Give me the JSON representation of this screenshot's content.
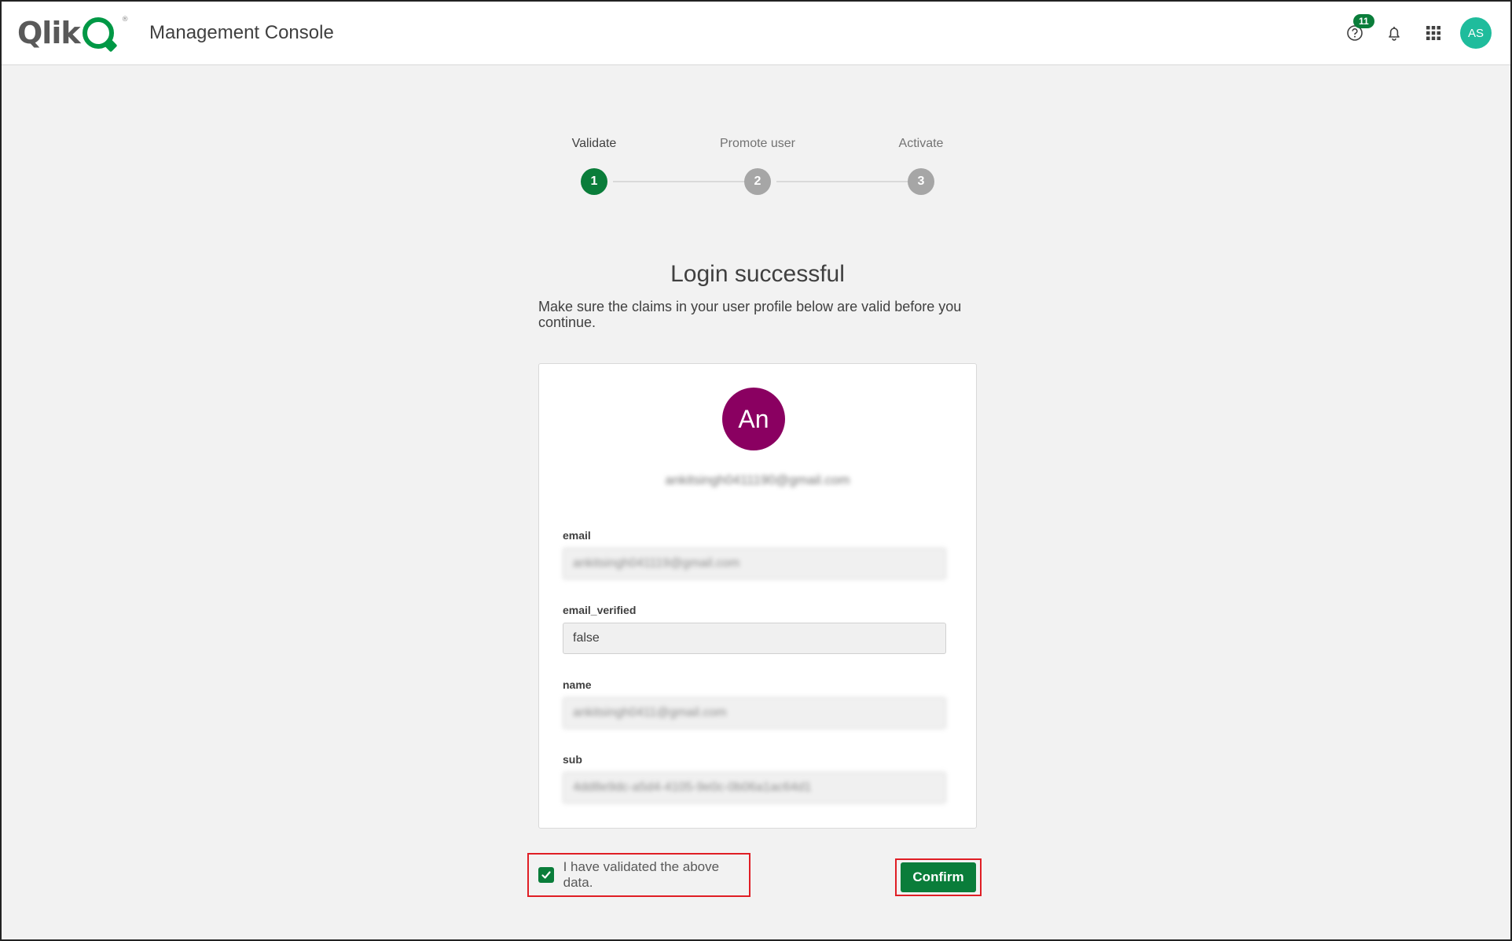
{
  "header": {
    "logo_text": "Qlik",
    "logo_reg": "®",
    "title": "Management Console",
    "help_badge_count": "11",
    "user_initials": "AS",
    "icons": [
      "help-icon",
      "bell-icon",
      "apps-grid-icon"
    ]
  },
  "stepper": {
    "steps": [
      {
        "label": "Validate",
        "number": "1",
        "state": "active"
      },
      {
        "label": "Promote user",
        "number": "2",
        "state": "inactive"
      },
      {
        "label": "Activate",
        "number": "3",
        "state": "inactive"
      }
    ]
  },
  "main": {
    "heading": "Login successful",
    "subtext": "Make sure the claims in your user profile below are valid before you continue."
  },
  "profile": {
    "avatar_initials": "An",
    "email_display": "ankitsingh0411190@gmail.com",
    "fields": [
      {
        "label": "email",
        "value": "ankitsingh041119@gmail.com",
        "blurred": true
      },
      {
        "label": "email_verified",
        "value": "false",
        "blurred": false
      },
      {
        "label": "name",
        "value": "ankitsingh0411@gmail.com",
        "blurred": true
      },
      {
        "label": "sub",
        "value": "4dd8e9dc-a5d4-4105-9e0c-0b06a1ac64d1",
        "blurred": true
      }
    ]
  },
  "footer": {
    "checkbox_label": "I have validated the above data.",
    "checkbox_checked": true,
    "confirm_label": "Confirm"
  },
  "colors": {
    "accent": "#0a7d3a",
    "avatar_top": "#1fbc9c",
    "avatar_profile": "#8a0061",
    "highlight": "#e01e25"
  }
}
